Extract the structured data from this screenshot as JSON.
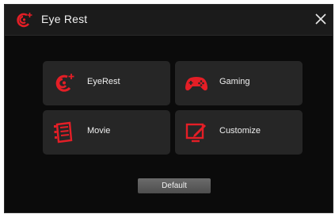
{
  "window": {
    "title": "Eye Rest",
    "title_icon": "eye-rest-logo-icon",
    "close_icon": "close-icon"
  },
  "modes": [
    {
      "label": "EyeRest",
      "icon": "eye-rest-icon"
    },
    {
      "label": "Gaming",
      "icon": "gamepad-icon"
    },
    {
      "label": "Movie",
      "icon": "film-icon"
    },
    {
      "label": "Customize",
      "icon": "edit-monitor-icon"
    }
  ],
  "footer": {
    "default_label": "Default"
  },
  "colors": {
    "accent": "#e41e26",
    "button_bg": "#262626",
    "window_bg": "#0b0b0b",
    "titlebar_bg": "#1b1b1b"
  }
}
